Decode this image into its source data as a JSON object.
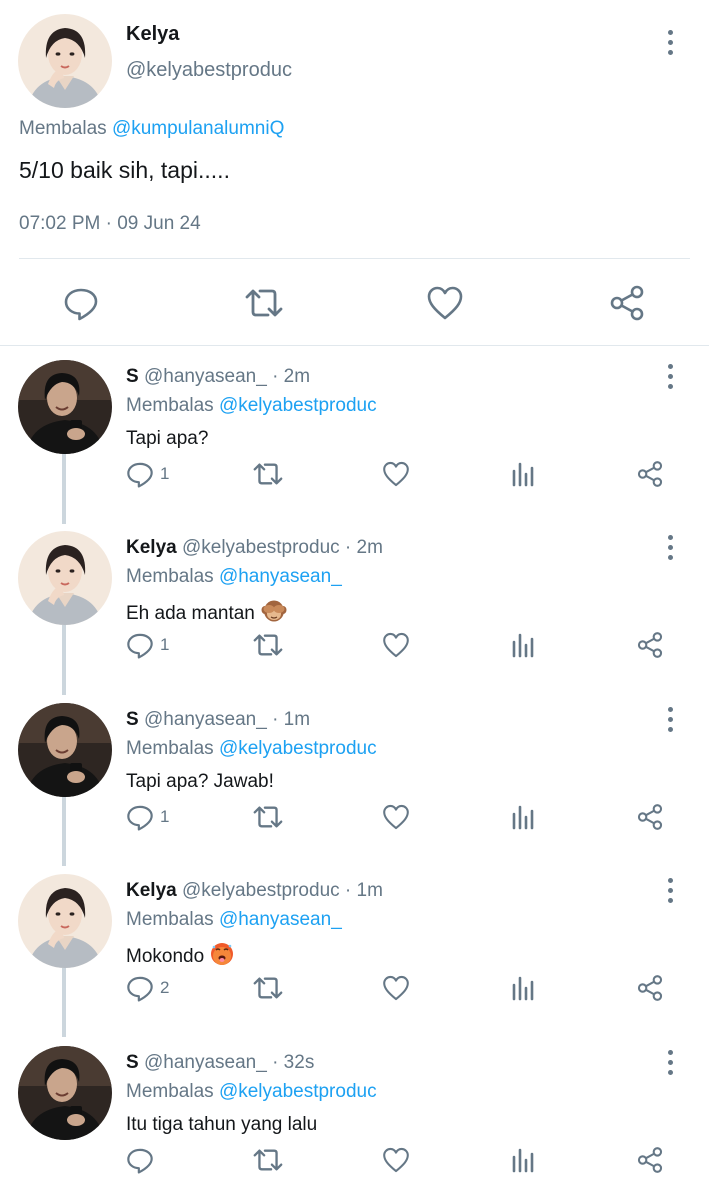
{
  "main_tweet": {
    "name": "Kelya",
    "handle": "@kelyabestproduc",
    "reply_prefix": "Membalas",
    "reply_mention": "@kumpulanalumniQ",
    "text": "5/10 baik sih, tapi.....",
    "timestamp": "07:02 PM · 09 Jun 24",
    "actions": [
      "reply-icon",
      "retweet-icon",
      "like-icon",
      "share-icon"
    ]
  },
  "replies": [
    {
      "name": "S",
      "handle": "@hanyasean_",
      "time": "· 2m",
      "reply_prefix": "Membalas",
      "reply_mention": "@kelyabestproduc",
      "text": "Tapi apa?",
      "emoji": "",
      "reply_count": "1",
      "avatar": "dark"
    },
    {
      "name": "Kelya",
      "handle": "@kelyabestproduc",
      "time": "· 2m",
      "reply_prefix": "Membalas",
      "reply_mention": "@hanyasean_",
      "text": "Eh ada mantan",
      "emoji": "see-no-evil-monkey",
      "reply_count": "1",
      "avatar": "light"
    },
    {
      "name": "S",
      "handle": "@hanyasean_",
      "time": "· 1m",
      "reply_prefix": "Membalas",
      "reply_mention": "@kelyabestproduc",
      "text": "Tapi apa? Jawab!",
      "emoji": "",
      "reply_count": "1",
      "avatar": "dark"
    },
    {
      "name": "Kelya",
      "handle": "@kelyabestproduc",
      "time": "· 1m",
      "reply_prefix": "Membalas",
      "reply_mention": "@hanyasean_",
      "text": "Mokondo",
      "emoji": "hot-face",
      "reply_count": "2",
      "avatar": "light"
    },
    {
      "name": "S",
      "handle": "@hanyasean_",
      "time": "· 32s",
      "reply_prefix": "Membalas",
      "reply_mention": "@kelyabestproduc",
      "text": "Itu tiga tahun yang lalu",
      "emoji": "",
      "reply_count": "",
      "avatar": "dark"
    }
  ],
  "colors": {
    "link": "#1da1f2",
    "secondary_text": "#657786",
    "primary_text": "#14171a",
    "divider": "#e1e8ed",
    "thread_line": "#ccd6dd"
  }
}
